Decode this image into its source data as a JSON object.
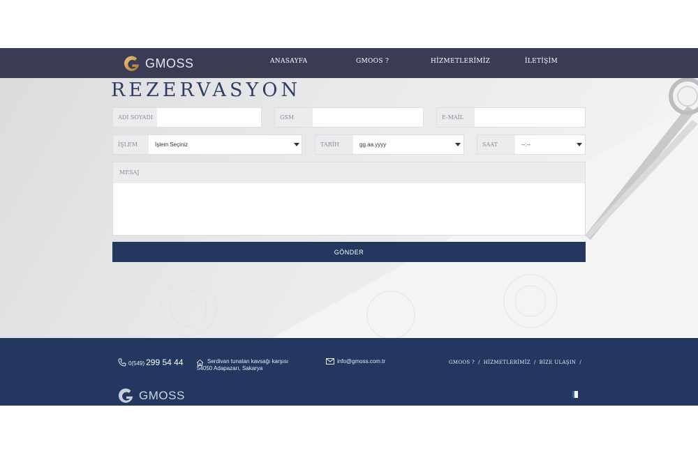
{
  "header": {
    "logo_text": "GMOSS",
    "nav": [
      "ANASAYFA",
      "GMOOS ?",
      "HİZMETLERİMİZ",
      "İLETİŞİM"
    ]
  },
  "form": {
    "title": "REZERVASYON",
    "name_label": "ADI SOYADI",
    "gsm_label": "GSM",
    "email_label": "E-MAİL",
    "service_label": "İŞLEM",
    "service_value": "İşlem Seçiniz",
    "date_label": "TARİH",
    "date_value": "gg.aa.yyyy",
    "time_label": "SAAT",
    "time_value": "--:--",
    "message_label": "MESAJ",
    "submit_label": "GÖNDER"
  },
  "footer": {
    "phone_prefix": "0(549)",
    "phone_number": "299 54 44",
    "address_line1": "Serdivan tunatan kavsağı karşısı",
    "address_line2": "54050 Adapazarı, Sakarya",
    "email": "info@gmoss.com.tr",
    "links": [
      "GMOOS ?",
      "HİZMETLERİMİZ",
      "BİZE ULAŞIN"
    ],
    "logo_text": "GMOSS"
  },
  "colors": {
    "header_bg": "#3b3b56",
    "accent_navy": "#233760",
    "title": "#2e3f63",
    "logo_gold": "#c99a4a"
  }
}
